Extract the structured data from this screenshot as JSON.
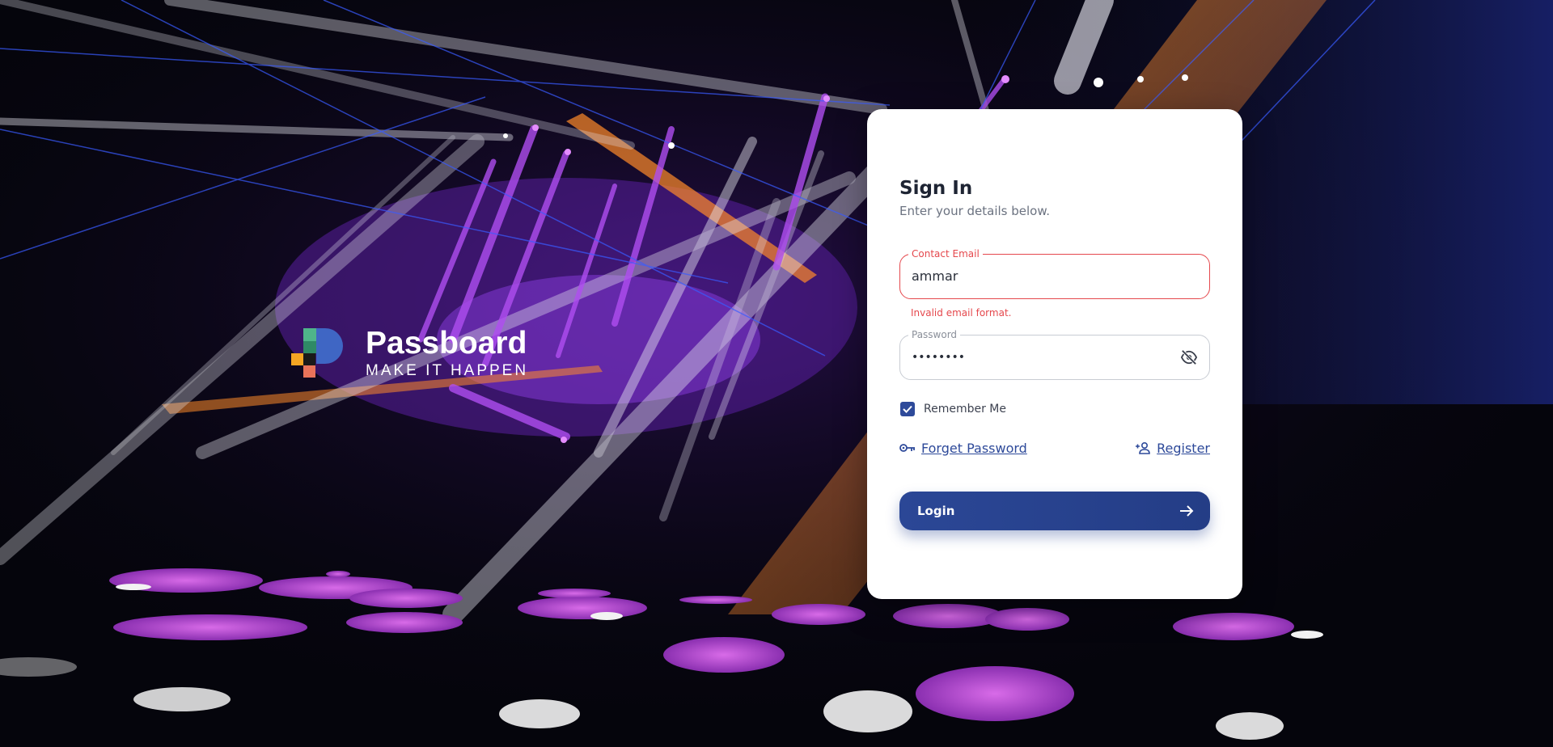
{
  "brand": {
    "name": "Passboard",
    "tagline": "MAKE IT HAPPEN"
  },
  "signin": {
    "title": "Sign In",
    "subtitle": "Enter your details below."
  },
  "email": {
    "label": "Contact Email",
    "value": "ammar",
    "error": "Invalid email format."
  },
  "password": {
    "label": "Password",
    "value": "••••••••"
  },
  "remember": {
    "label": "Remember Me",
    "checked": true
  },
  "links": {
    "forgot": "Forget Password",
    "register": "Register"
  },
  "login": {
    "label": "Login"
  },
  "colors": {
    "primary": "#2e4a9a",
    "error": "#e5484d",
    "card": "#ffffff"
  },
  "icons": {
    "password_toggle": "eye-off-icon",
    "forgot": "key-icon",
    "register": "person-add-icon",
    "login": "arrow-right-icon"
  }
}
